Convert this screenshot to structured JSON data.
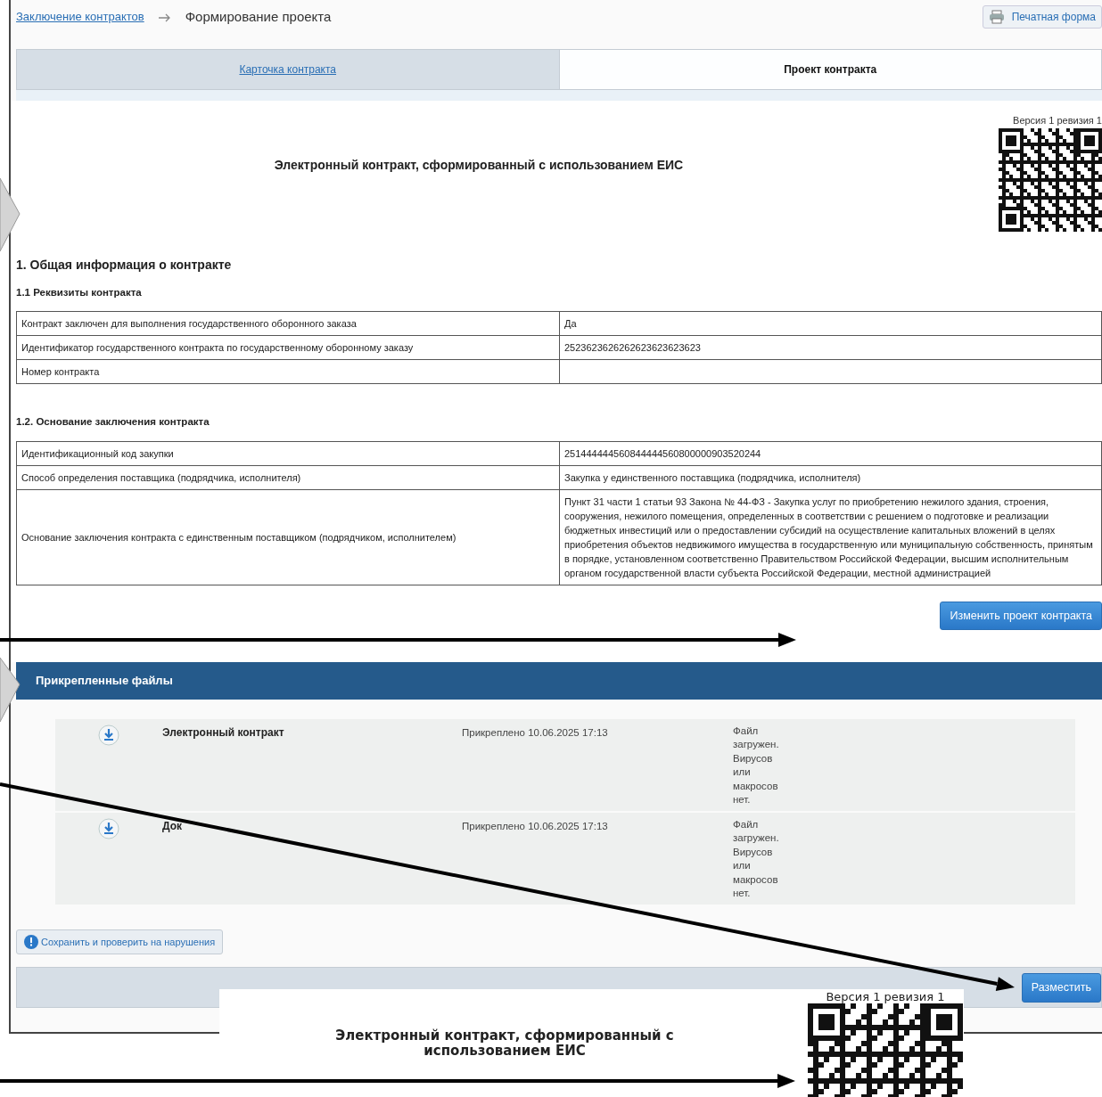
{
  "breadcrumb": {
    "parent": "Заключение контрактов",
    "current": "Формирование проекта"
  },
  "print_button": {
    "label": "Печатная форма"
  },
  "tabs": [
    {
      "label": "Карточка контракта",
      "selected": false
    },
    {
      "label": "Проект контракта",
      "selected": true
    }
  ],
  "document": {
    "version": "Версия 1 ревизия 1",
    "title": "Электронный контракт, сформированный с использованием ЕИС",
    "section_title": "1. Общая информация о контракте",
    "subsections": [
      {
        "title": "1.1 Реквизиты контракта",
        "rows": [
          {
            "label": "Контракт заключен для выполнения государственного оборонного заказа",
            "value": "Да"
          },
          {
            "label": "Идентификатор государственного контракта по государственному оборонному заказу",
            "value": "2523623626262623623623623"
          },
          {
            "label": "Номер контракта"
          }
        ]
      },
      {
        "title": "1.2. Основание заключения контракта",
        "rows": [
          {
            "label": "Идентификационный код закупки",
            "value": "251444444560844444560800000903520244"
          },
          {
            "label": "Способ определения поставщика (подрядчика, исполнителя)",
            "value": "Закупка у единственного поставщика (подрядчика, исполнителя)"
          },
          {
            "label": "Основание заключения контракта с единственным поставщиком (подрядчиком, исполнителем)",
            "value": "Пункт 31 части 1 статьи 93 Закона № 44-ФЗ - Закупка услуг по приобретению нежилого здания, строения, сооружения, нежилого помещения, определенных в соответствии с решением о подготовке и реализации бюджетных инвестиций или о предоставлении субсидий на осуществление капитальных вложений в целях приобретения объектов недвижимого имущества в государственную или муниципальную собственность, принятым в порядке, установленном соответственно Правительством Российской Федерации, высшим исполнительным органом государственной власти субъекта Российской Федерации, местной администрацией"
          }
        ]
      }
    ]
  },
  "edit_button": "Изменить проект контракта",
  "files_panel": {
    "title": "Прикрепленные файлы",
    "files": [
      {
        "name": "Электронный контракт",
        "attached": "Прикреплено 10.06.2025 17:13",
        "status": "Файл загружен. Вирусов или макросов нет."
      },
      {
        "name": "Док",
        "attached": "Прикреплено 10.06.2025 17:13",
        "status": "Файл загружен. Вирусов или макросов нет."
      }
    ]
  },
  "check_button": "Сохранить и проверить на нарушения",
  "publish_button": "Разместить",
  "inset": {
    "version": "Версия 1 ревизия 1",
    "title": "Электронный контракт, сформированный с использованием ЕИС"
  }
}
